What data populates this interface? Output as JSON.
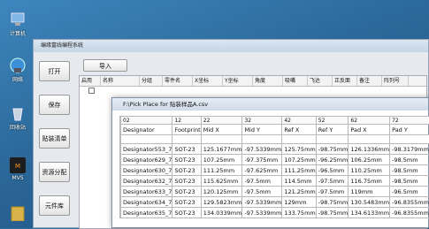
{
  "desktop": {
    "icons": [
      {
        "name": "computer",
        "label": "计算机",
        "color": "#5a9fd4"
      },
      {
        "name": "network",
        "label": "网络",
        "color": "#4aa1e0"
      },
      {
        "name": "recycle",
        "label": "回收站",
        "color": "#b9c7d6"
      },
      {
        "name": "mvs",
        "label": "MVS",
        "color": "#e07a1c"
      },
      {
        "name": "folder",
        "label": "",
        "color": "#d9b24a"
      }
    ]
  },
  "main_window": {
    "title": "编缘富线编程系统",
    "left_buttons": [
      "打开",
      "保存",
      "贴装清单",
      "资源分配",
      "元件库"
    ],
    "import_label": "导入",
    "grid_headers": [
      "启用",
      "名称",
      "分组",
      "零件名",
      "X坐标",
      "Y坐标",
      "角度",
      "吸嘴",
      "飞达",
      "正反面",
      "备注",
      "阵列号"
    ]
  },
  "csv_window": {
    "title": "F:\\Pick Place for 贴装样品A.csv",
    "col_numbers": [
      "02",
      "12",
      "22",
      "32",
      "42",
      "52",
      "62",
      "72"
    ],
    "headers": [
      "Designator",
      "Footprint",
      "Mid X",
      "Mid Y",
      "Ref X",
      "Ref Y",
      "Pad X",
      "Pad Y"
    ],
    "rows": [
      [
        "Designator553_7",
        "SOT-23",
        "125.1677mm",
        "-97.5339mm",
        "125.75mm",
        "-98.75mm",
        "126.1336mm",
        "-98.3179mm"
      ],
      [
        "Designator629_7",
        "SOT-23",
        "107.25mm",
        "-97.375mm",
        "107.25mm",
        "-96.25mm",
        "106.25mm",
        "-98.5mm"
      ],
      [
        "Designator630_7",
        "SOT-23",
        "111.25mm",
        "-97.625mm",
        "111.25mm",
        "-96.5mm",
        "110.25mm",
        "-98.5mm"
      ],
      [
        "Designator632_7",
        "SOT-23",
        "115.625mm",
        "-97.5mm",
        "114.5mm",
        "-97.5mm",
        "116.75mm",
        "-98.5mm"
      ],
      [
        "Designator633_7",
        "SOT-23",
        "120.125mm",
        "-97.5mm",
        "121.25mm",
        "-97.5mm",
        "119mm",
        "-96.5mm"
      ],
      [
        "Designator634_7",
        "SOT-23",
        "129.5823mm",
        "-97.5339mm",
        "129mm",
        "-98.75mm",
        "130.5483mm",
        "-96.8355mm"
      ],
      [
        "Designator635_7",
        "SOT-23",
        "134.0339mm",
        "-97.5339mm",
        "133.75mm",
        "-98.75mm",
        "134.6133mm",
        "-96.8355mm"
      ]
    ]
  }
}
